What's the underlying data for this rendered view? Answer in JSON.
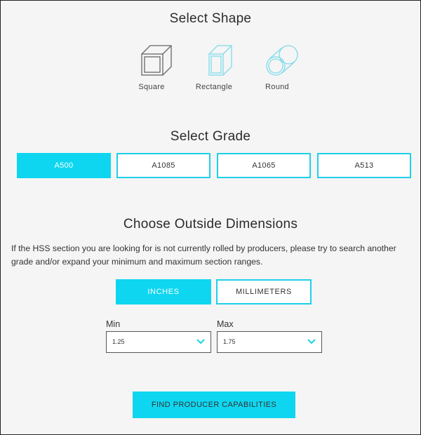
{
  "shape_section": {
    "title": "Select Shape",
    "shapes": [
      {
        "label": "Square",
        "icon": "square-tube-icon"
      },
      {
        "label": "Rectangle",
        "icon": "rectangle-tube-icon"
      },
      {
        "label": "Round",
        "icon": "round-tube-icon"
      }
    ]
  },
  "grade_section": {
    "title": "Select Grade",
    "grades": [
      {
        "label": "A500",
        "active": true
      },
      {
        "label": "A1085",
        "active": false
      },
      {
        "label": "A1065",
        "active": false
      },
      {
        "label": "A513",
        "active": false
      }
    ]
  },
  "dimensions_section": {
    "title": "Choose Outside Dimensions",
    "description": "If the HSS section you are looking for is not currently rolled by producers, please try to search another grade and/or expand your minimum and maximum section ranges.",
    "units": [
      {
        "label": "INCHES",
        "active": true
      },
      {
        "label": "MILLIMETERS",
        "active": false
      }
    ],
    "min": {
      "label": "Min",
      "value": "1.25"
    },
    "max": {
      "label": "Max",
      "value": "1.75"
    }
  },
  "submit_label": "FIND PRODUCER CAPABILITIES",
  "colors": {
    "accent": "#0fd6f0",
    "border": "#1ed0e8",
    "background": "#f5f5f5"
  }
}
